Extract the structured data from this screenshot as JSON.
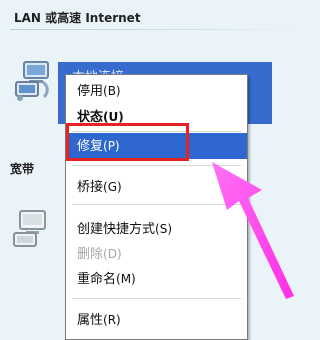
{
  "header": {
    "title": "LAN 或高速 Internet"
  },
  "connection": {
    "name_partial": "本地连接"
  },
  "broadband": {
    "label": "宽带"
  },
  "context_menu": {
    "items": [
      {
        "label": "停用",
        "shortcut": "(B)"
      },
      {
        "label": "状态",
        "shortcut": "(U)"
      },
      {
        "label": "修复",
        "shortcut": "(P)"
      },
      {
        "label": "桥接",
        "shortcut": "(G)"
      },
      {
        "label": "创建快捷方式",
        "shortcut": "(S)"
      },
      {
        "label": "删除",
        "shortcut": "(D)"
      },
      {
        "label": "重命名",
        "shortcut": "(M)"
      },
      {
        "label": "属性",
        "shortcut": "(R)"
      }
    ]
  },
  "icons": {
    "network": "network-computer-icon",
    "arrow": "pointer-arrow-icon"
  },
  "colors": {
    "selection_blue": "#2e67cf",
    "highlight_red": "#e72222",
    "arrow_magenta": "#ff4df2",
    "background": "#e9f3f8"
  }
}
